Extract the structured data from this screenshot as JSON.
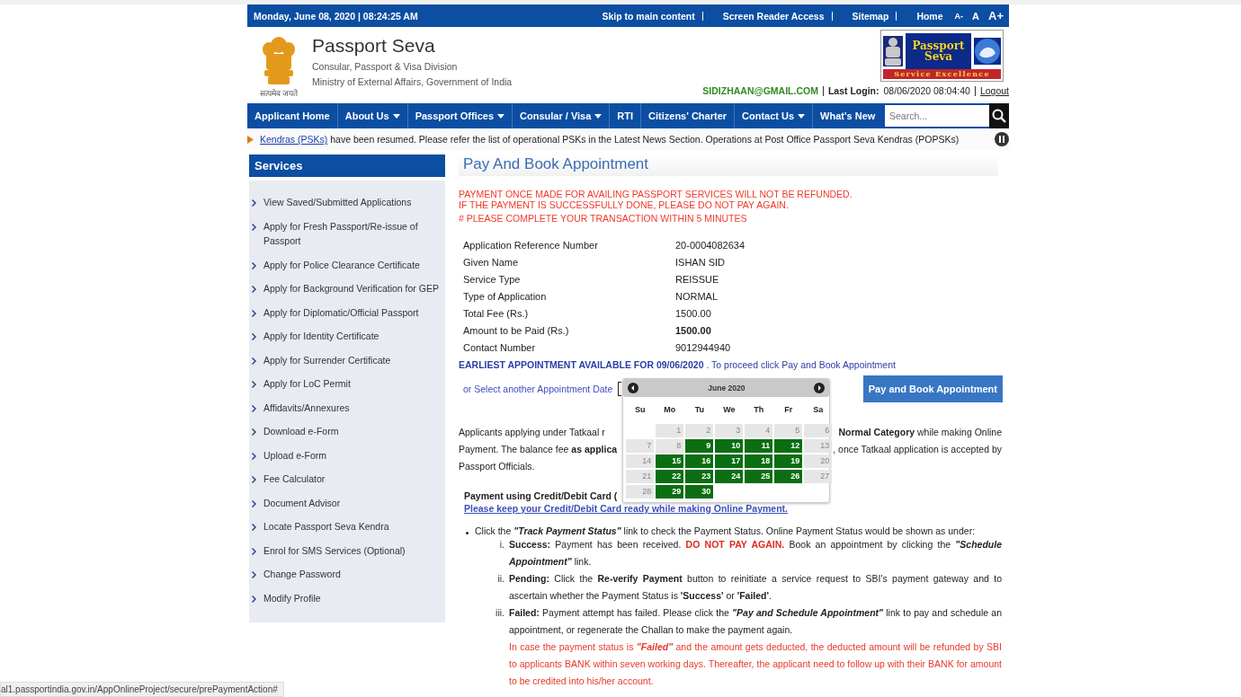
{
  "top_bar": {
    "date": "Monday,  June  08, 2020 | 08:24:25 AM",
    "links": [
      "Skip to main content",
      "Screen Reader Access",
      "Sitemap"
    ],
    "home": "Home",
    "font_sizes": [
      "A-",
      "A",
      "A+"
    ]
  },
  "header": {
    "title": "Passport Seva",
    "subtitles": [
      "Consular, Passport & Visa Division",
      "Ministry of External Affairs, Government of India"
    ],
    "emblem_caption": "सत्यमेव जयते",
    "badge": {
      "title": "Passport Seva",
      "tagline": "Service Excellence"
    },
    "user_email": "SIDIZHAAN@GMAIL.COM",
    "last_login_label": "Last Login:",
    "last_login": "08/06/2020 08:04:40",
    "logout": "Logout"
  },
  "nav": {
    "items": [
      {
        "label": "Applicant Home",
        "dropdown": false
      },
      {
        "label": "About Us",
        "dropdown": true
      },
      {
        "label": "Passport Offices",
        "dropdown": true
      },
      {
        "label": "Consular / Visa",
        "dropdown": true
      },
      {
        "label": "RTI",
        "dropdown": false
      },
      {
        "label": "Citizens' Charter",
        "dropdown": false
      },
      {
        "label": "Contact Us",
        "dropdown": true
      },
      {
        "label": "What's New",
        "dropdown": false
      }
    ],
    "search": {
      "placeholder": "Search..."
    }
  },
  "ticker": {
    "link": "Kendras (PSKs)",
    "text": " have been resumed. Please refer the list of operational PSKs in the Latest News Section. Operations at Post Office Passport Seva Kendras (POPSKs)"
  },
  "sidebar": {
    "title": "Services",
    "items": [
      "View Saved/Submitted Applications",
      "Apply for Fresh Passport/Re-issue of Passport",
      "Apply for Police Clearance Certificate",
      "Apply for Background Verification for GEP",
      "Apply for Diplomatic/Official Passport",
      "Apply for Identity Certificate",
      "Apply for Surrender Certificate",
      "Apply for LoC Permit",
      "Affidavits/Annexures",
      "Download e-Form",
      "Upload e-Form",
      "Fee Calculator",
      "Document Advisor",
      "Locate Passport Seva Kendra",
      "Enrol for SMS Services (Optional)",
      "Change Password",
      "Modify Profile"
    ]
  },
  "main": {
    "title": "Pay And Book Appointment",
    "warnings": [
      "PAYMENT ONCE MADE FOR AVAILING PASSPORT SERVICES WILL NOT BE REFUNDED.",
      "IF THE PAYMENT IS SUCCESSFULLY DONE, PLEASE DO NOT PAY AGAIN.",
      "# PLEASE COMPLETE YOUR TRANSACTION WITHIN 5 MINUTES"
    ],
    "details": [
      {
        "label": "Application Reference Number",
        "value": "20-0004082634",
        "bold": false
      },
      {
        "label": "Given Name",
        "value": "ISHAN SID",
        "bold": false
      },
      {
        "label": "Service Type",
        "value": "REISSUE",
        "bold": false
      },
      {
        "label": "Type of Application",
        "value": "NORMAL",
        "bold": false
      },
      {
        "label": "Total Fee (Rs.)",
        "value": "1500.00",
        "bold": false
      },
      {
        "label": "Amount to be Paid (Rs.)",
        "value": "1500.00",
        "bold": true
      },
      {
        "label": "Contact Number",
        "value": "9012944940",
        "bold": false
      }
    ],
    "earliest": "**EARLIEST APPOINTMENT AVAILABLE FOR 09/06/2020** . To proceed click Pay and Book Appointment",
    "select_label": "or Select another Appointment Date",
    "pay_button": "Pay and Book Appointment",
    "calendar": {
      "month": "June 2020",
      "weekdays": [
        "Su",
        "Mo",
        "Tu",
        "We",
        "Th",
        "Fr",
        "Sa"
      ],
      "days": [
        {
          "day": "1",
          "available": false
        },
        {
          "day": "2",
          "available": false
        },
        {
          "day": "3",
          "available": false
        },
        {
          "day": "4",
          "available": false
        },
        {
          "day": "5",
          "available": false
        },
        {
          "day": "6",
          "available": false
        },
        {
          "day": "7",
          "available": false
        },
        {
          "day": "8",
          "available": false
        },
        {
          "day": "9",
          "available": true
        },
        {
          "day": "10",
          "available": true
        },
        {
          "day": "11",
          "available": true
        },
        {
          "day": "12",
          "available": true
        },
        {
          "day": "13",
          "available": false
        },
        {
          "day": "14",
          "available": false
        },
        {
          "day": "15",
          "available": true
        },
        {
          "day": "16",
          "available": true
        },
        {
          "day": "17",
          "available": true
        },
        {
          "day": "18",
          "available": true
        },
        {
          "day": "19",
          "available": true
        },
        {
          "day": "20",
          "available": false
        },
        {
          "day": "21",
          "available": false
        },
        {
          "day": "22",
          "available": true
        },
        {
          "day": "23",
          "available": true
        },
        {
          "day": "24",
          "available": true
        },
        {
          "day": "25",
          "available": true
        },
        {
          "day": "26",
          "available": true
        },
        {
          "day": "27",
          "available": false
        },
        {
          "day": "28",
          "available": false
        },
        {
          "day": "29",
          "available": true
        },
        {
          "day": "30",
          "available": true
        }
      ]
    },
    "tatkaal_lines": [
      {
        "left": "Applicants applying under Tatkaal r",
        "right": "**Normal Category** while making Online"
      },
      {
        "left": "Payment. The balance fee **as applica**",
        "right": ", once Tatkaal application is accepted by"
      },
      {
        "left": "Passport Officials."
      }
    ],
    "payment_heading": "Payment using Credit/Debit Card (",
    "payment_link": "Please keep your Credit/Debit Card ready while making Online Payment.",
    "bullet": [
      {
        "kind": "plain",
        "text": "Click the "
      },
      {
        "kind": "emphasis",
        "text": "\"Track Payment Status\""
      },
      {
        "kind": "plain",
        "text": " link to check the Payment Status. Online Payment Status would be shown as under:"
      }
    ],
    "statuses": [
      {
        "marker": "i.",
        "segments": [
          {
            "kind": "plain",
            "text": "**Success:** Payment has been received. "
          },
          {
            "kind": "alert",
            "text": "DO NOT PAY AGAIN."
          },
          {
            "kind": "plain",
            "text": " Book an appointment by clicking the "
          },
          {
            "kind": "emphasis",
            "text": "\"Schedule Appointment\""
          },
          {
            "kind": "plain",
            "text": " link."
          }
        ]
      },
      {
        "marker": "ii.",
        "segments": [
          {
            "kind": "plain",
            "text": "**Pending:** Click the **Re-verify Payment** button to reinitiate a service request to SBI's payment gateway and to ascertain whether the Payment Status is **'Success'** or **'Failed'**."
          }
        ]
      },
      {
        "marker": "iii.",
        "segments": [
          {
            "kind": "plain",
            "text": "**Failed:** Payment attempt has failed. Please click the "
          },
          {
            "kind": "emphasis",
            "text": "\"Pay and Schedule Appointment\""
          },
          {
            "kind": "plain",
            "text": " link to pay and schedule an appointment, or regenerate the Challan to make the payment again."
          }
        ],
        "note": [
          {
            "kind": "plain",
            "text": "In case the payment status is "
          },
          {
            "kind": "emphasis",
            "text": "\"Failed\""
          },
          {
            "kind": "plain",
            "text": " and the amount gets deducted, the deducted amount will be refunded by SBI to applicants BANK within seven working days. Thereafter, the applicant need to follow up with their BANK for amount to be credited into his/her account."
          }
        ]
      }
    ]
  },
  "status_url": "al1.passportindia.gov.in/AppOnlineProject/secure/prePaymentAction#"
}
